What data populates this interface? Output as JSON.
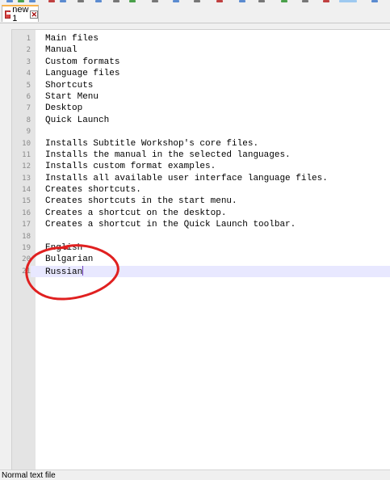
{
  "tab": {
    "label": "new 1",
    "close_glyph": "✕",
    "icon": "save-state-icon",
    "close_icon": "close-icon"
  },
  "editor": {
    "current_line": 21,
    "lines": [
      {
        "num": "1",
        "text": "Main files"
      },
      {
        "num": "2",
        "text": "Manual"
      },
      {
        "num": "3",
        "text": "Custom formats"
      },
      {
        "num": "4",
        "text": "Language files"
      },
      {
        "num": "5",
        "text": "Shortcuts"
      },
      {
        "num": "6",
        "text": "Start Menu"
      },
      {
        "num": "7",
        "text": "Desktop"
      },
      {
        "num": "8",
        "text": "Quick Launch"
      },
      {
        "num": "9",
        "text": ""
      },
      {
        "num": "10",
        "text": "Installs Subtitle Workshop's core files."
      },
      {
        "num": "11",
        "text": "Installs the manual in the selected languages."
      },
      {
        "num": "12",
        "text": "Installs custom format examples."
      },
      {
        "num": "13",
        "text": "Installs all available user interface language files."
      },
      {
        "num": "14",
        "text": "Creates shortcuts."
      },
      {
        "num": "15",
        "text": "Creates shortcuts in the start menu."
      },
      {
        "num": "16",
        "text": "Creates a shortcut on the desktop."
      },
      {
        "num": "17",
        "text": "Creates a shortcut in the Quick Launch toolbar."
      },
      {
        "num": "18",
        "text": ""
      },
      {
        "num": "19",
        "text": "English"
      },
      {
        "num": "20",
        "text": "Bulgarian"
      },
      {
        "num": "21",
        "text": "Russian"
      }
    ]
  },
  "status": {
    "file_type": "Normal text file"
  },
  "colors": {
    "annotation": "#e02020",
    "current_line_bg": "#e8e8ff",
    "gutter_bg": "#e4e4e4",
    "tab_accent": "#fab34a"
  }
}
